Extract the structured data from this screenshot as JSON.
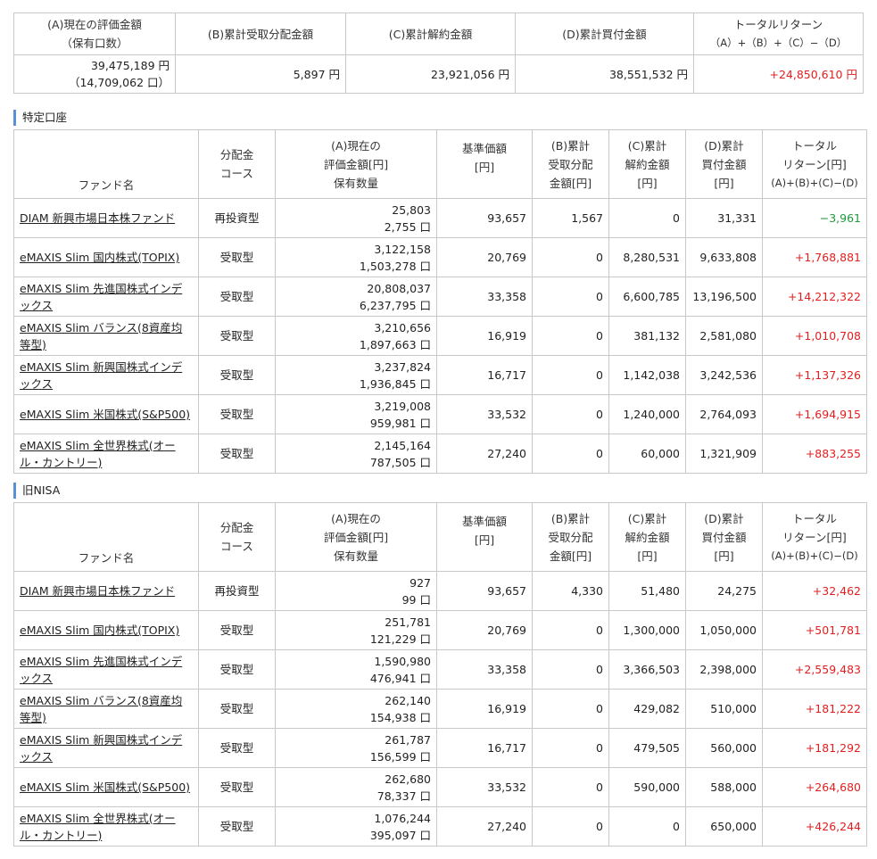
{
  "summary": {
    "headers": [
      [
        "(A)現在の評価金額",
        "（保有口数）"
      ],
      [
        "(B)累計受取分配金額"
      ],
      [
        "(C)累計解約金額"
      ],
      [
        "(D)累計買付金額"
      ],
      [
        "トータルリターン",
        "（A）+（B）+（C）−（D）"
      ]
    ],
    "values": {
      "a_amount": "39,475,189 円",
      "a_units": "（14,709,062 口）",
      "b": "5,897 円",
      "c": "23,921,056 円",
      "d": "38,551,532 円",
      "total": "+24,850,610 円"
    }
  },
  "table_headers": {
    "fund_name": "ファンド名",
    "course": [
      "分配金",
      "コース"
    ],
    "a": [
      "(A)現在の",
      "評価金額[円]",
      "保有数量"
    ],
    "base_price": [
      "基準価額",
      "[円]"
    ],
    "b": [
      "(B)累計",
      "受取分配",
      "金額[円]"
    ],
    "c": [
      "(C)累計",
      "解約金額",
      "[円]"
    ],
    "d": [
      "(D)累計",
      "買付金額",
      "[円]"
    ],
    "total": [
      "トータル",
      "リターン[円]",
      "(A)+(B)+(C)−(D)"
    ]
  },
  "sections": [
    {
      "title": "特定口座",
      "rows": [
        {
          "name": "DIAM 新興市場日本株ファンド",
          "course": "再投資型",
          "amount": "25,803",
          "units": "2,755 口",
          "base": "93,657",
          "b": "1,567",
          "c": "0",
          "d": "31,331",
          "total": "−3,961",
          "sign": "neg"
        },
        {
          "name": "eMAXIS Slim 国内株式(TOPIX)",
          "course": "受取型",
          "amount": "3,122,158",
          "units": "1,503,278 口",
          "base": "20,769",
          "b": "0",
          "c": "8,280,531",
          "d": "9,633,808",
          "total": "+1,768,881",
          "sign": "pos"
        },
        {
          "name": "eMAXIS Slim 先進国株式インデックス",
          "course": "受取型",
          "amount": "20,808,037",
          "units": "6,237,795 口",
          "base": "33,358",
          "b": "0",
          "c": "6,600,785",
          "d": "13,196,500",
          "total": "+14,212,322",
          "sign": "pos"
        },
        {
          "name": "eMAXIS Slim バランス(8資産均等型)",
          "course": "受取型",
          "amount": "3,210,656",
          "units": "1,897,663 口",
          "base": "16,919",
          "b": "0",
          "c": "381,132",
          "d": "2,581,080",
          "total": "+1,010,708",
          "sign": "pos"
        },
        {
          "name": "eMAXIS Slim 新興国株式インデックス",
          "course": "受取型",
          "amount": "3,237,824",
          "units": "1,936,845 口",
          "base": "16,717",
          "b": "0",
          "c": "1,142,038",
          "d": "3,242,536",
          "total": "+1,137,326",
          "sign": "pos"
        },
        {
          "name": "eMAXIS Slim 米国株式(S&P500)",
          "course": "受取型",
          "amount": "3,219,008",
          "units": "959,981 口",
          "base": "33,532",
          "b": "0",
          "c": "1,240,000",
          "d": "2,764,093",
          "total": "+1,694,915",
          "sign": "pos"
        },
        {
          "name": "eMAXIS Slim 全世界株式(オール・カントリー)",
          "course": "受取型",
          "amount": "2,145,164",
          "units": "787,505 口",
          "base": "27,240",
          "b": "0",
          "c": "60,000",
          "d": "1,321,909",
          "total": "+883,255",
          "sign": "pos"
        }
      ]
    },
    {
      "title": "旧NISA",
      "rows": [
        {
          "name": "DIAM 新興市場日本株ファンド",
          "course": "再投資型",
          "amount": "927",
          "units": "99 口",
          "base": "93,657",
          "b": "4,330",
          "c": "51,480",
          "d": "24,275",
          "total": "+32,462",
          "sign": "pos"
        },
        {
          "name": "eMAXIS Slim 国内株式(TOPIX)",
          "course": "受取型",
          "amount": "251,781",
          "units": "121,229 口",
          "base": "20,769",
          "b": "0",
          "c": "1,300,000",
          "d": "1,050,000",
          "total": "+501,781",
          "sign": "pos"
        },
        {
          "name": "eMAXIS Slim 先進国株式インデックス",
          "course": "受取型",
          "amount": "1,590,980",
          "units": "476,941 口",
          "base": "33,358",
          "b": "0",
          "c": "3,366,503",
          "d": "2,398,000",
          "total": "+2,559,483",
          "sign": "pos"
        },
        {
          "name": "eMAXIS Slim バランス(8資産均等型)",
          "course": "受取型",
          "amount": "262,140",
          "units": "154,938 口",
          "base": "16,919",
          "b": "0",
          "c": "429,082",
          "d": "510,000",
          "total": "+181,222",
          "sign": "pos"
        },
        {
          "name": "eMAXIS Slim 新興国株式インデックス",
          "course": "受取型",
          "amount": "261,787",
          "units": "156,599 口",
          "base": "16,717",
          "b": "0",
          "c": "479,505",
          "d": "560,000",
          "total": "+181,292",
          "sign": "pos"
        },
        {
          "name": "eMAXIS Slim 米国株式(S&P500)",
          "course": "受取型",
          "amount": "262,680",
          "units": "78,337 口",
          "base": "33,532",
          "b": "0",
          "c": "590,000",
          "d": "588,000",
          "total": "+264,680",
          "sign": "pos"
        },
        {
          "name": "eMAXIS Slim 全世界株式(オール・カントリー)",
          "course": "受取型",
          "amount": "1,076,244",
          "units": "395,097 口",
          "base": "27,240",
          "b": "0",
          "c": "0",
          "d": "650,000",
          "total": "+426,244",
          "sign": "pos"
        }
      ]
    }
  ],
  "colors": {
    "positive": "#e02020",
    "negative": "#1e9a3a",
    "section_bar": "#5b8fd6",
    "border": "#c8c8c8"
  }
}
